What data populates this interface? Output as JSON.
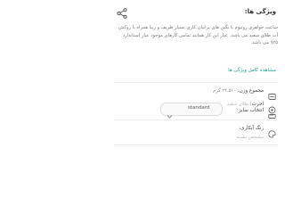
{
  "card": {
    "title": "ویژگی ها:",
    "description": "ساعت جواهری روتیوم با نگین های براتیان کاری بسیار ظریف و زیبا همراه با روکش آب طلای سفید می باشد. عیار این کار همانند تمامی کارهای موجود عیار استاندارد ۹۲۵ می باشد.",
    "see_all_link": "مشاهده کامل ویژگی ها",
    "weight_label": "مجموع وزن:",
    "weight_value": "۲۴.۵۱۰ گرم",
    "material_label": "اجرت:",
    "material_value": "طلای سفید",
    "size_label": "انتخاب سایز:",
    "size_value": "standard",
    "color_label": "رنگ آبکاری:",
    "color_note": "مشخص نشده"
  },
  "colors": {
    "accent": "#19a68f",
    "text": "#333333",
    "muted": "#8a8a8a"
  }
}
